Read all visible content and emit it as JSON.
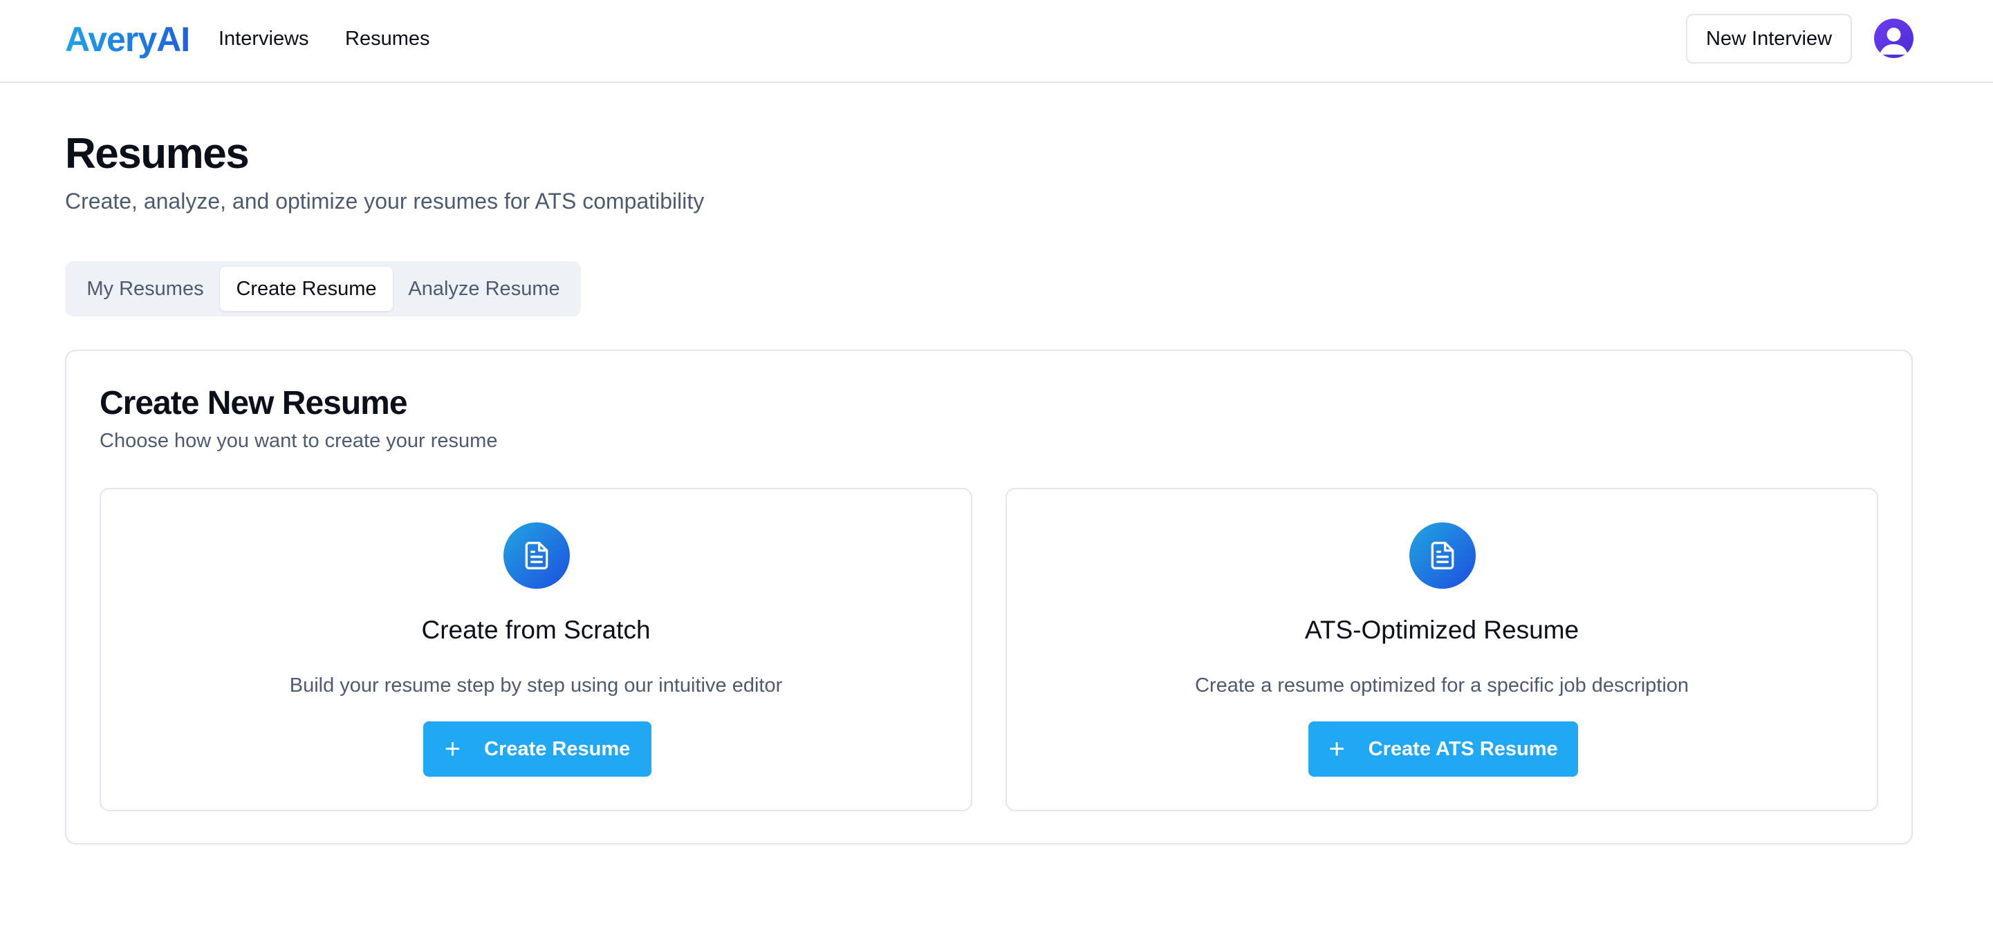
{
  "header": {
    "brand": "AveryAI",
    "nav": [
      {
        "label": "Interviews"
      },
      {
        "label": "Resumes"
      }
    ],
    "new_interview_label": "New Interview",
    "avatar_icon": "user-avatar-icon"
  },
  "page": {
    "title": "Resumes",
    "subtitle": "Create, analyze, and optimize your resumes for ATS compatibility"
  },
  "tabs": [
    {
      "label": "My Resumes",
      "active": false
    },
    {
      "label": "Create Resume",
      "active": true
    },
    {
      "label": "Analyze Resume",
      "active": false
    }
  ],
  "card": {
    "title": "Create New Resume",
    "subtitle": "Choose how you want to create your resume",
    "options": [
      {
        "icon": "document-icon",
        "title": "Create from Scratch",
        "description": "Build your resume step by step using our intuitive editor",
        "button_label": "Create Resume",
        "button_icon": "plus-icon"
      },
      {
        "icon": "document-icon",
        "title": "ATS-Optimized Resume",
        "description": "Create a resume optimized for a specific job description",
        "button_label": "Create ATS Resume",
        "button_icon": "plus-icon"
      }
    ]
  },
  "colors": {
    "brand_gradient_start": "#1fa2e6",
    "brand_gradient_end": "#1d5fe0",
    "primary_button": "#21a8f5",
    "avatar": "#5b34e6",
    "muted_text": "#4d5a70"
  }
}
